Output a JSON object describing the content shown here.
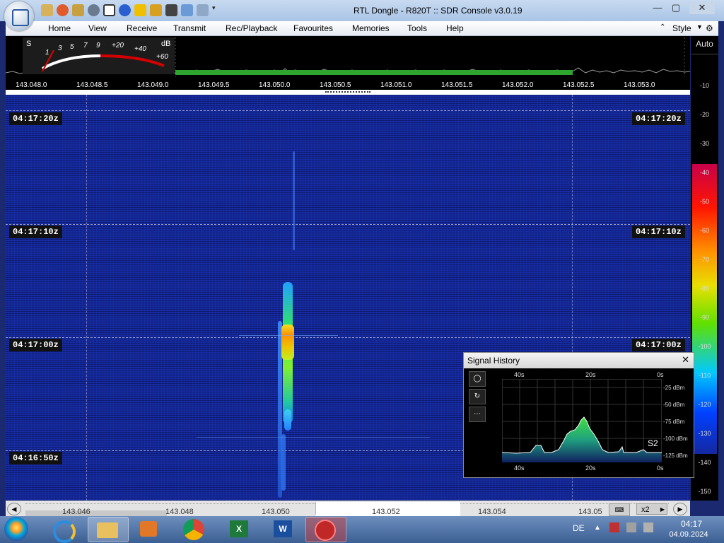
{
  "window": {
    "title": "RTL Dongle - R820T :: SDR Console v3.0.19",
    "minimize_label": "—",
    "maximize_label": "▢",
    "close_label": "✕"
  },
  "menu": {
    "items": [
      "Home",
      "View",
      "Receive",
      "Transmit",
      "Rec/Playback",
      "Favourites",
      "Memories",
      "Tools",
      "Help"
    ],
    "style_label": "Style"
  },
  "smeter": {
    "s_label": "S",
    "db_label": "dB",
    "ticks": [
      "1",
      "3",
      "5",
      "7",
      "9",
      "+20",
      "+40",
      "+60"
    ]
  },
  "frequency_ruler": [
    "143.048.0",
    "143.048.5",
    "143.049.0",
    "143.049.5",
    "143.050.0",
    "143.050.5",
    "143.051.0",
    "143.051.5",
    "143.052.0",
    "143.052.5",
    "143.053.0"
  ],
  "waterfall": {
    "time_labels": [
      "04:17:20z",
      "04:17:10z",
      "04:17:00z",
      "04:16:50z"
    ]
  },
  "level_scale": {
    "auto_label": "Auto",
    "labels": [
      "-10",
      "-20",
      "-30",
      "-40",
      "-50",
      "-60",
      "-70",
      "-80",
      "-90",
      "-100",
      "-110",
      "-120",
      "-130",
      "-140",
      "-150"
    ]
  },
  "signal_history": {
    "title": "Signal History",
    "close_label": "✕",
    "top_ticks": [
      "40s",
      "20s",
      "0s"
    ],
    "bottom_ticks": [
      "40s",
      "20s",
      "0s"
    ],
    "dbm_labels": [
      "-25 dBm",
      "-50 dBm",
      "-75 dBm",
      "-100 dBm",
      "-125 dBm"
    ],
    "s_reading": "S2",
    "tools": [
      "◯",
      "↻",
      "⋯"
    ]
  },
  "status": {
    "freqs": [
      "143.046",
      "143.048",
      "143.050",
      "143.052",
      "143.054",
      "143.05"
    ],
    "zoom_label": "x2"
  },
  "taskbar": {
    "language": "DE",
    "time": "04:17",
    "date": "04.09.2024"
  }
}
